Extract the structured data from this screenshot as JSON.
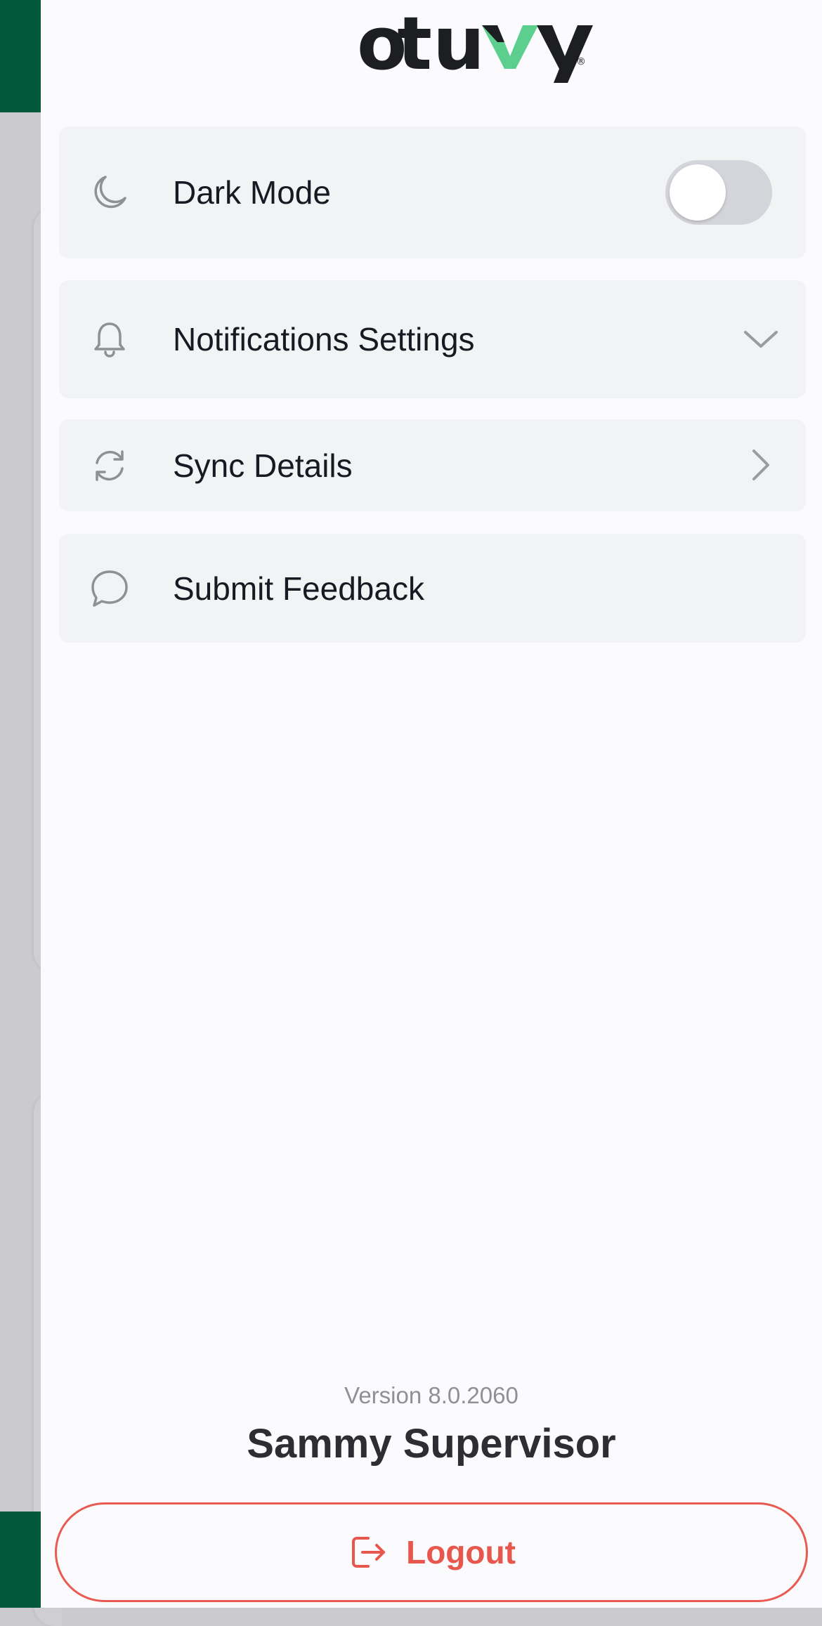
{
  "brand": {
    "logo_text": "otuvy",
    "registered_mark": "®",
    "accent_color": "#5ccf8e",
    "primary_green": "#02583a"
  },
  "menu": {
    "dark_mode": {
      "icon": "moon-icon",
      "label": "Dark Mode",
      "toggle_on": false
    },
    "notifications": {
      "icon": "bell-icon",
      "label": "Notifications Settings",
      "indicator": "chevron-down-icon"
    },
    "sync": {
      "icon": "sync-icon",
      "label": "Sync Details",
      "indicator": "chevron-right-icon"
    },
    "feedback": {
      "icon": "chat-bubble-icon",
      "label": "Submit Feedback"
    }
  },
  "footer": {
    "version": "Version 8.0.2060",
    "user_name": "Sammy Supervisor",
    "logout_label": "Logout",
    "logout_icon": "logout-icon",
    "logout_color": "#e8574d"
  }
}
